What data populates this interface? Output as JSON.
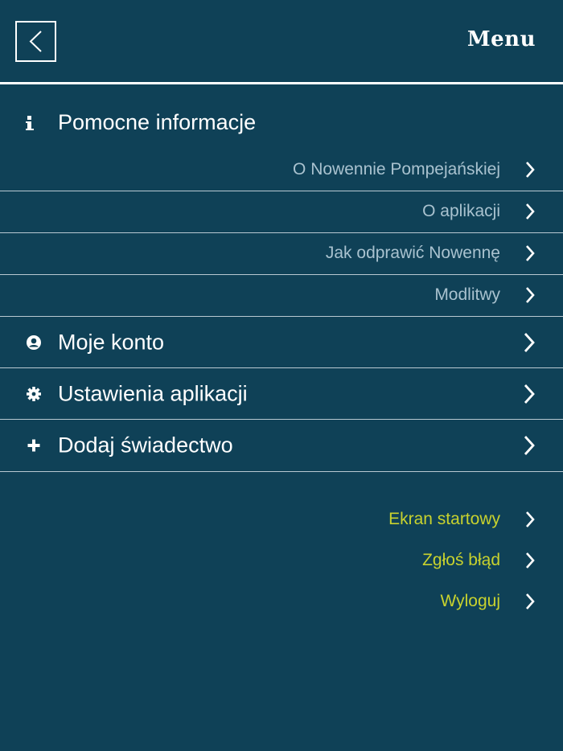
{
  "header": {
    "title": "Menu",
    "back_icon": "chevron-left-icon"
  },
  "helpful_info": {
    "title": "Pomocne informacje",
    "icon": "info-icon",
    "items": [
      {
        "label": "O Nowennie Pompejańskiej"
      },
      {
        "label": "O aplikacji"
      },
      {
        "label": "Jak odprawić Nowennę"
      },
      {
        "label": "Modlitwy"
      }
    ]
  },
  "main_items": [
    {
      "label": "Moje konto",
      "icon": "user-icon"
    },
    {
      "label": "Ustawienia aplikacji",
      "icon": "gear-icon"
    },
    {
      "label": "Dodaj świadectwo",
      "icon": "plus-icon"
    }
  ],
  "footer_links": [
    {
      "label": "Ekran startowy"
    },
    {
      "label": "Zgłoś błąd"
    },
    {
      "label": "Wyloguj"
    }
  ],
  "colors": {
    "background": "#0f4157",
    "text_primary": "#ffffff",
    "text_secondary": "#a9c2cf",
    "accent_link": "#c8d22e"
  }
}
